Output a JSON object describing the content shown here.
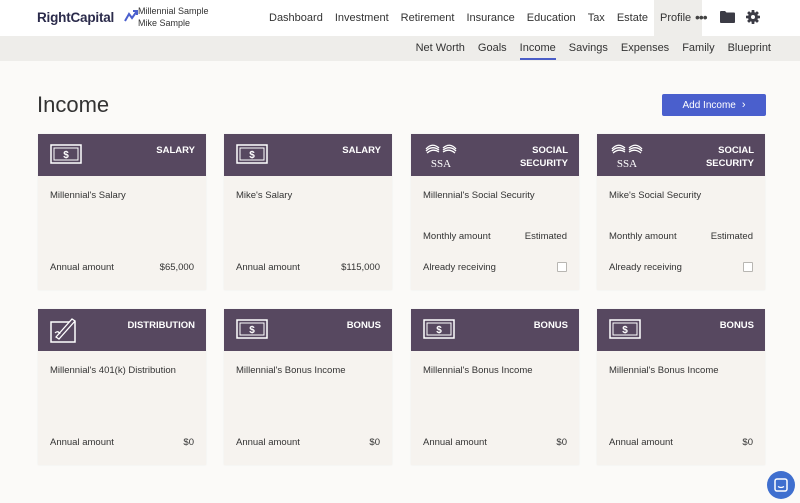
{
  "app": {
    "logo_text": "RightCapital"
  },
  "clients": {
    "primary": "Millennial Sample",
    "secondary": "Mike Sample"
  },
  "main_nav": [
    {
      "label": "Dashboard"
    },
    {
      "label": "Investment"
    },
    {
      "label": "Retirement"
    },
    {
      "label": "Insurance"
    },
    {
      "label": "Education"
    },
    {
      "label": "Tax"
    },
    {
      "label": "Estate"
    },
    {
      "label": "Profile",
      "active": true
    }
  ],
  "toolbar": {
    "more_label": "•••",
    "icons": [
      "folder-icon",
      "gear-icon"
    ]
  },
  "sub_nav": [
    {
      "label": "Net Worth"
    },
    {
      "label": "Goals"
    },
    {
      "label": "Income",
      "active": true
    },
    {
      "label": "Savings"
    },
    {
      "label": "Expenses"
    },
    {
      "label": "Family"
    },
    {
      "label": "Blueprint"
    }
  ],
  "page": {
    "title": "Income",
    "add_button": "Add Income"
  },
  "colors": {
    "card_header": "#574860",
    "accent": "#4a5fcd",
    "card_body": "#f6f3ef"
  },
  "cards": [
    {
      "icon": "dollar-bill-icon",
      "type_line1": "SALARY",
      "type_line2": "",
      "name": "Millennial's Salary",
      "row1_label": "",
      "row1_value": "",
      "row2_label": "Annual amount",
      "row2_value": "$65,000"
    },
    {
      "icon": "dollar-bill-icon",
      "type_line1": "SALARY",
      "type_line2": "",
      "name": "Mike's Salary",
      "row1_label": "",
      "row1_value": "",
      "row2_label": "Annual amount",
      "row2_value": "$115,000"
    },
    {
      "icon": "ssa-logo-icon",
      "type_line1": "SOCIAL",
      "type_line2": "SECURITY",
      "name": "Millennial's Social Security",
      "row1_label": "Monthly amount",
      "row1_value": "Estimated",
      "row2_label": "Already receiving",
      "row2_value": "",
      "checkbox_checked": false
    },
    {
      "icon": "ssa-logo-icon",
      "type_line1": "SOCIAL",
      "type_line2": "SECURITY",
      "name": "Mike's Social Security",
      "row1_label": "Monthly amount",
      "row1_value": "Estimated",
      "row2_label": "Already receiving",
      "row2_value": "",
      "checkbox_checked": false
    },
    {
      "icon": "signature-pen-icon",
      "type_line1": "DISTRIBUTION",
      "type_line2": "",
      "name": "Millennial's 401(k) Distribution",
      "row1_label": "",
      "row1_value": "",
      "row2_label": "Annual amount",
      "row2_value": "$0"
    },
    {
      "icon": "dollar-bill-icon",
      "type_line1": "BONUS",
      "type_line2": "",
      "name": "Millennial's Bonus Income",
      "row1_label": "",
      "row1_value": "",
      "row2_label": "Annual amount",
      "row2_value": "$0"
    },
    {
      "icon": "dollar-bill-icon",
      "type_line1": "BONUS",
      "type_line2": "",
      "name": "Millennial's Bonus Income",
      "row1_label": "",
      "row1_value": "",
      "row2_label": "Annual amount",
      "row2_value": "$0"
    },
    {
      "icon": "dollar-bill-icon",
      "type_line1": "BONUS",
      "type_line2": "",
      "name": "Millennial's Bonus Income",
      "row1_label": "",
      "row1_value": "",
      "row2_label": "Annual amount",
      "row2_value": "$0"
    }
  ],
  "chat": {
    "icon": "chat-icon"
  }
}
